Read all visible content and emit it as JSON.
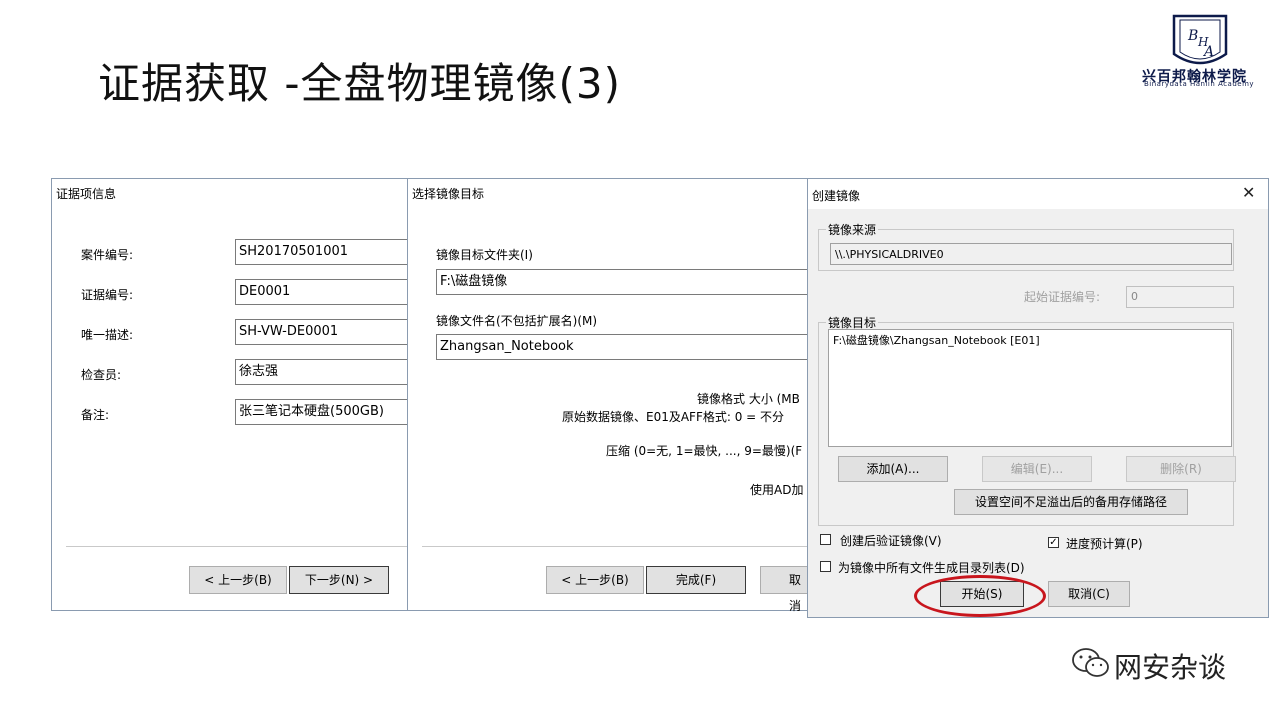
{
  "slide": {
    "title": "证据获取 -全盘物理镜像(3)",
    "logo_text": "兴百邦翰林学院",
    "logo_sub": "Binarydata Hanlin Academy",
    "logo_letters": "BHA",
    "watermark": "网安杂谈"
  },
  "dialog1": {
    "title": "证据项信息",
    "fields": [
      {
        "label": "案件编号:",
        "value": "SH20170501001"
      },
      {
        "label": "证据编号:",
        "value": "DE0001"
      },
      {
        "label": "唯一描述:",
        "value": "SH-VW-DE0001"
      },
      {
        "label": "检查员:",
        "value": "徐志强"
      },
      {
        "label": "备注:",
        "value": "张三笔记本硬盘(500GB)"
      }
    ],
    "back_label": "< 上一步(B)",
    "next_label": "下一步(N) >"
  },
  "dialog2": {
    "title": "选择镜像目标",
    "folder_label": "镜像目标文件夹(I)",
    "folder_value": "F:\\磁盘镜像",
    "filename_label": "镜像文件名(不包括扩展名)(M)",
    "filename_value": "Zhangsan_Notebook",
    "format_label": "镜像格式 大小 (MB",
    "raw_label": "原始数据镜像、E01及AFF格式: 0 = 不分",
    "compress_label": "压缩 (0=无, 1=最快, ..., 9=最慢)(F",
    "ad_label": "使用AD加",
    "back_label": "< 上一步(B)",
    "finish_label": "完成(F)",
    "cancel_label": "取消"
  },
  "dialog3": {
    "title": "创建镜像",
    "source_group": "镜像来源",
    "source_value": "\\\\.\\PHYSICALDRIVE0",
    "start_evidence_label": "起始证据编号:",
    "start_evidence_value": "0",
    "target_group": "镜像目标",
    "target_item": "F:\\磁盘镜像\\Zhangsan_Notebook [E01]",
    "add_label": "添加(A)...",
    "edit_label": "编辑(E)...",
    "delete_label": "删除(R)",
    "backup_path_label": "设置空间不足溢出后的备用存储路径",
    "verify_label": "创建后验证镜像(V)",
    "verify_checked": false,
    "progress_label": "进度预计算(P)",
    "progress_checked": true,
    "dirlist_label": "为镜像中所有文件生成目录列表(D)",
    "dirlist_checked": false,
    "start_label": "开始(S)",
    "cancel_label": "取消(C)"
  },
  "colors": {
    "highlight_oval": "#c8161d",
    "dialog_border": "#8a9bb0",
    "dialog_bg_gray": "#f0f0f0"
  }
}
